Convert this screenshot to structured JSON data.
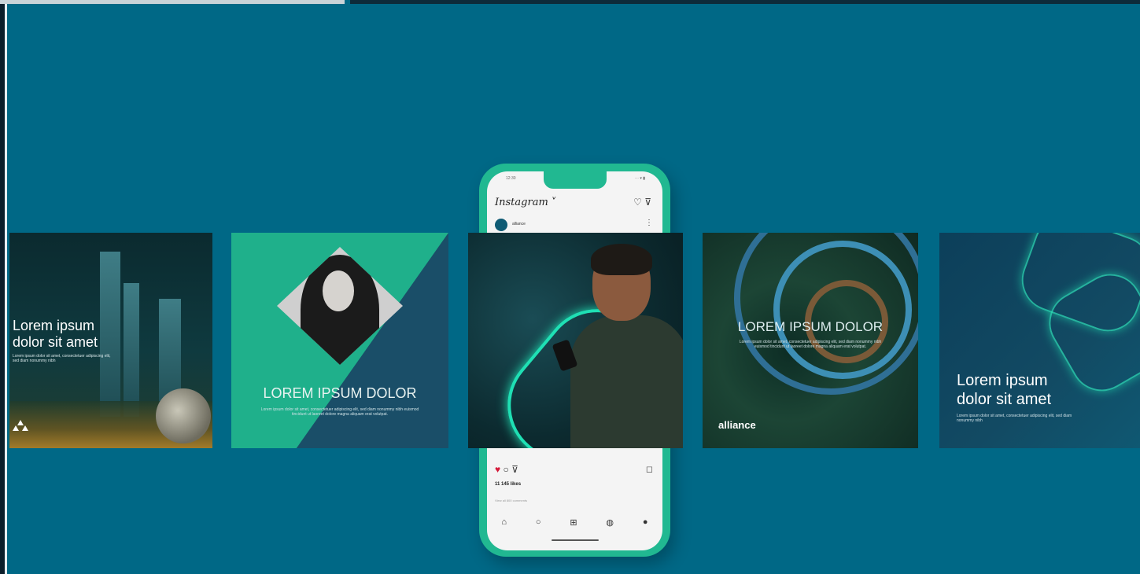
{
  "cards": {
    "card1": {
      "title": "Lorem ipsum\ndolor sit amet",
      "body": "Lorem ipsum dolor sit amet, consectetuer adipiscing elit, sed diam nonummy nibh"
    },
    "card2": {
      "title": "LOREM IPSUM DOLOR",
      "body": "Lorem ipsum dolor sit amet, consectetuer adipiscing elit, sed diam nonummy nibh euismod tincidunt ut laoreet dolore magna aliquam erat volutpat."
    },
    "card4": {
      "title": "LOREM IPSUM DOLOR",
      "body": "Lorem ipsum dolor sit amet, consectetuer adipiscing elit, sed diam nonummy nibh euismod tincidunt ut laoreet dolore magna aliquam erat volutpat.",
      "logo": "alliance"
    },
    "card5": {
      "title": "Lorem ipsum\ndolor sit amet",
      "body": "Lorem ipsum dolor sit amet, consectetuer adipiscing elit, sed diam nonummy nibh"
    }
  },
  "phone": {
    "status_time": "12:30",
    "status_right": "··· ▾ ▮",
    "app_title": "Instagram ˅",
    "header_icons": "♡  ⊽",
    "account": "alliance",
    "menu_dots": "⋮",
    "action_heart": "♥",
    "action_comment": "○",
    "action_share": "⊽",
    "bookmark": "◻",
    "likes": "11 145 likes",
    "comments": "View all 800 comments",
    "tab_home": "⌂",
    "tab_search": "○",
    "tab_add": "⊞",
    "tab_shop": "◍",
    "tab_profile": "●"
  },
  "icons": [
    "heart-icon",
    "comment-icon",
    "share-icon",
    "bookmark-icon",
    "home-icon",
    "search-icon",
    "add-icon",
    "shop-icon",
    "profile-icon"
  ],
  "colors": {
    "background": "#006886",
    "phone": "#21b891",
    "accent": "#1fe0b4"
  }
}
